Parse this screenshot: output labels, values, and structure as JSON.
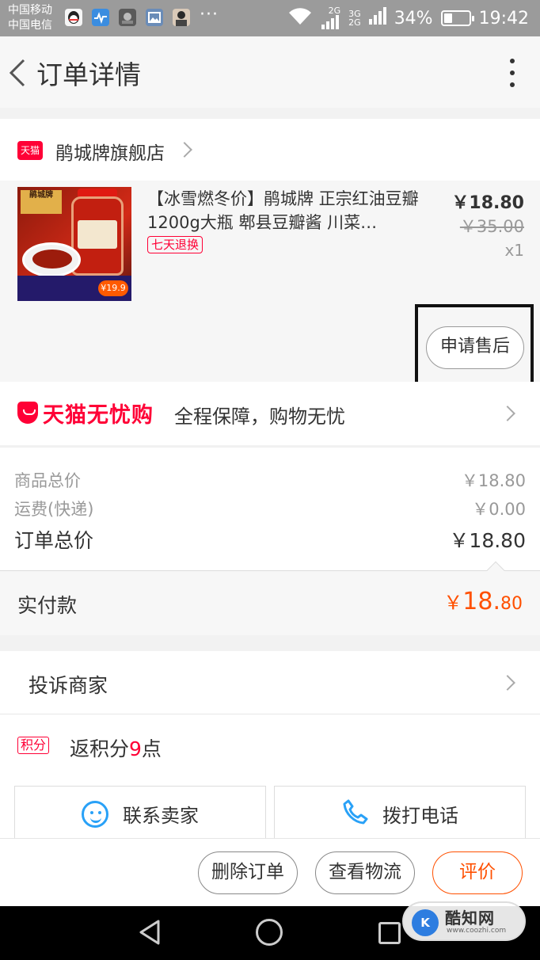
{
  "status_bar": {
    "carrier_1": "中国移动",
    "carrier_2": "中国电信",
    "dots": "···",
    "net_1_top": "2G",
    "net_2_top": "3G",
    "net_2_bottom": "2G",
    "battery_text": "34%",
    "battery_level": 0.34,
    "time": "19:42"
  },
  "nav": {
    "title": "订单详情"
  },
  "shop": {
    "badge": "天猫",
    "name": "鹃城牌旗舰店"
  },
  "product": {
    "title": "【冰雪燃冬价】鹃城牌 正宗红油豆瓣1200g大瓶 郫县豆瓣酱 川菜…",
    "tag": "七天退换",
    "price": "￥18.80",
    "original_price": "￥35.00",
    "quantity": "x1",
    "after_sale_label": "申请售后",
    "thumbnail": {
      "top_text": "鹃城牌",
      "price_badge": "¥19.9"
    }
  },
  "guarantee": {
    "brand": "天猫无忧购",
    "text": "全程保障，购物无忧"
  },
  "summary": {
    "goods_label": "商品总价",
    "goods_value": "￥18.80",
    "shipping_label": "运费(快递)",
    "shipping_value": "￥0.00",
    "total_label": "订单总价",
    "total_value": "￥18.80"
  },
  "payment": {
    "label": "实付款",
    "currency": "￥",
    "integer": "18.",
    "decimal": "80"
  },
  "complain": {
    "label": "投诉商家"
  },
  "points": {
    "badge": "积分",
    "text_before": "返积分",
    "value": "9",
    "text_after": "点"
  },
  "contact": {
    "seller_label": "联系卖家",
    "phone_label": "拨打电话"
  },
  "actions": {
    "delete_label": "删除订单",
    "logistics_label": "查看物流",
    "review_label": "评价"
  },
  "watermark": {
    "logo": "K",
    "name": "酷知网",
    "url": "www.coozhi.com"
  },
  "colors": {
    "tmall_red": "#ff0036",
    "price_orange": "#ff5000",
    "accent_blue": "#29a1f7"
  }
}
